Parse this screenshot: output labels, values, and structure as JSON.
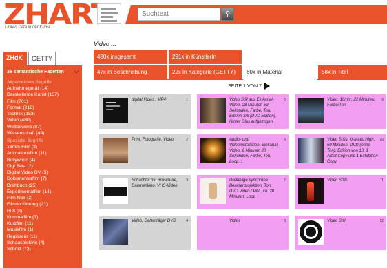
{
  "header": {
    "logo": "ZHART",
    "tagline": "Linked Data in der Kunst",
    "search_placeholder": "Suchtext"
  },
  "sidebar": {
    "tabs": [
      {
        "label": "ZHdK"
      },
      {
        "label": "GETTY"
      }
    ],
    "facets_heading": "36 semantische Facetten",
    "group_allgemein": "Allgemeinere Begriffe",
    "allgemein": [
      "Aufnahmegerät  (14)",
      "Darstellende Kunst  (157)",
      "Film  (701)",
      "Format  (218)",
      "Technik  (153)",
      "Video  (480)",
      "Wettbewerb  (87)",
      "Wissenschaft  (49)"
    ],
    "group_speziell": "Spezielle Begriffe",
    "speziell": [
      "16mm-Film  (3)",
      "Animationsfilm  (11)",
      "Bollywood  (4)",
      "Digi Beta  (2)",
      "Digital Video DV  (3)",
      "Dokumentarfilm  (7)",
      "Drehbuch  (25)",
      "Experimentalfilm  (14)",
      "Film Noir  (2)",
      "Filmvorführung  (21)",
      "Hi 8  (8)",
      "Kriminalfilm  (1)",
      "Kurzfilm  (11)",
      "Musikfilm  (1)",
      "Regisseur  (11)",
      "Schauspielerin  (4)",
      "Schnitt  (73)"
    ]
  },
  "main": {
    "title": "Video ...",
    "tabs": [
      {
        "label": "480x insgesamt"
      },
      {
        "label": "291x in KünstlerIn"
      },
      {
        "label": "47x in Beschreibung"
      },
      {
        "label": "22x in Kategorie (GETTY)"
      },
      {
        "label": "80x in Material"
      },
      {
        "label": "58x in Titel"
      }
    ],
    "pager": "SEITE 1 VON 7"
  },
  "cards": [
    {
      "num": "1",
      "text": "digital Video ; MP4"
    },
    {
      "num": "2",
      "text": "Print, Fotografie, Video"
    },
    {
      "num": "3",
      "text": "Schachtel mit Broschüre, Daumenkino, VHS-Video"
    },
    {
      "num": "4",
      "text": "Video, Datenträger DVD"
    },
    {
      "num": "5",
      "text": "Video Still aus Einkanal-Video, 28 Minuten 53 Sekunden, Farbe, Ton, Edition 3/6 (DVD Edition). Hinter Glas aufgezogen"
    },
    {
      "num": "6",
      "text": "Audio- und Videoinstallation, Einkanal-Video, 6 Minuten 20 Sekunden, Farbe, Ton, Loop. 1"
    },
    {
      "num": "7",
      "text": "Dreiteilige synchrone Beamerprojektion, Ton, DVD Video / PAL, ca. 20 Minuten, Loop"
    },
    {
      "num": "8",
      "text": "Video"
    },
    {
      "num": "9",
      "text": "Video, 16mm, 22 Minuten, Farbe/Ton"
    },
    {
      "num": "10",
      "text": "Video Stills, U-Matic High, 60 Minuten, DVD (ohne Ton), Edition von 10, 1 Artist Copy und 1 Exhibition Copy"
    },
    {
      "num": "11",
      "text": "Video Stills"
    },
    {
      "num": "12",
      "text": "Video Still"
    }
  ]
}
